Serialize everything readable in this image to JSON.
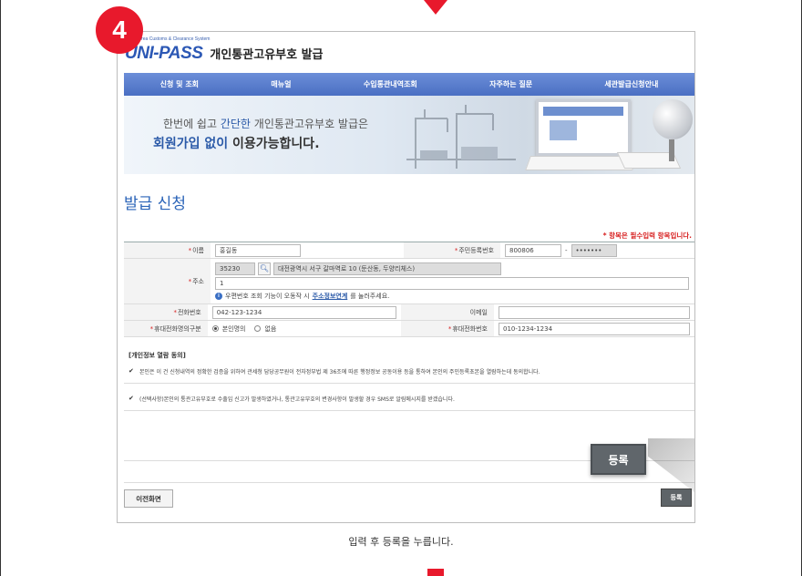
{
  "step": "4",
  "logo": {
    "tagline": "Korea Customs & Clearance System",
    "brand": "UNI-PASS",
    "title": "개인통관고유부호 발급"
  },
  "nav": [
    "신청 및 조회",
    "매뉴얼",
    "수입통관내역조회",
    "자주하는 질문",
    "세관발급신청안내"
  ],
  "banner": {
    "l1_pre": "한번에 쉽고 ",
    "l1_hl": "간단한",
    "l1_post": " 개인통관고유부호 발급은",
    "l2_hl": "회원가입 없이",
    "l2_post": " 이용가능합니다."
  },
  "heading": "발급 신청",
  "required_note": "* 항목은 필수입력 항목입니다.",
  "form": {
    "name_label": "이름",
    "name_value": "홍길동",
    "rrn_label": "주민등록번호",
    "rrn_front": "800806",
    "rrn_sep": "-",
    "rrn_back": "•••••••",
    "address_label": "주소",
    "zip": "35230",
    "address1": "대전광역시 서구 갈마역로 10 (둔산동, 두양리체스)",
    "address2": "1",
    "address_help_pre": "우편번호 조회 기능이 오동작 시 ",
    "address_help_link": "주소정보연계",
    "address_help_post": "를 눌러주세요.",
    "phone_label": "전화번호",
    "phone_value": "042-123-1234",
    "email_label": "이메일",
    "email_value": "",
    "owner_label": "휴대전화명의구분",
    "owner_opt1": "본인명의",
    "owner_opt2": "없음",
    "mobile_label": "휴대전화번호",
    "mobile_value": "010-1234-1234"
  },
  "consent": {
    "title": "[개인정보 열람 동의]",
    "c1": "본인은 이 건 신청내역의 정확한 검증을 위하여 관세청 담당공무원이 전자정부법 제 36조에 따른 행정정보 공동이용 등을 통하여 본인의 주민등록초본을 열람하는데 동의합니다.",
    "c2": "(선택사항)본인의 통관고유부호로 수출입 신고가 발생하였거나, 통관고유부호의 변경사항이 발생할 경우 SMS로 알림메시지를 받겠습니다."
  },
  "buttons": {
    "zoom": "등록",
    "prev": "이전화면",
    "register": "등록"
  },
  "caption": "입력 후 등록을 누릅니다."
}
